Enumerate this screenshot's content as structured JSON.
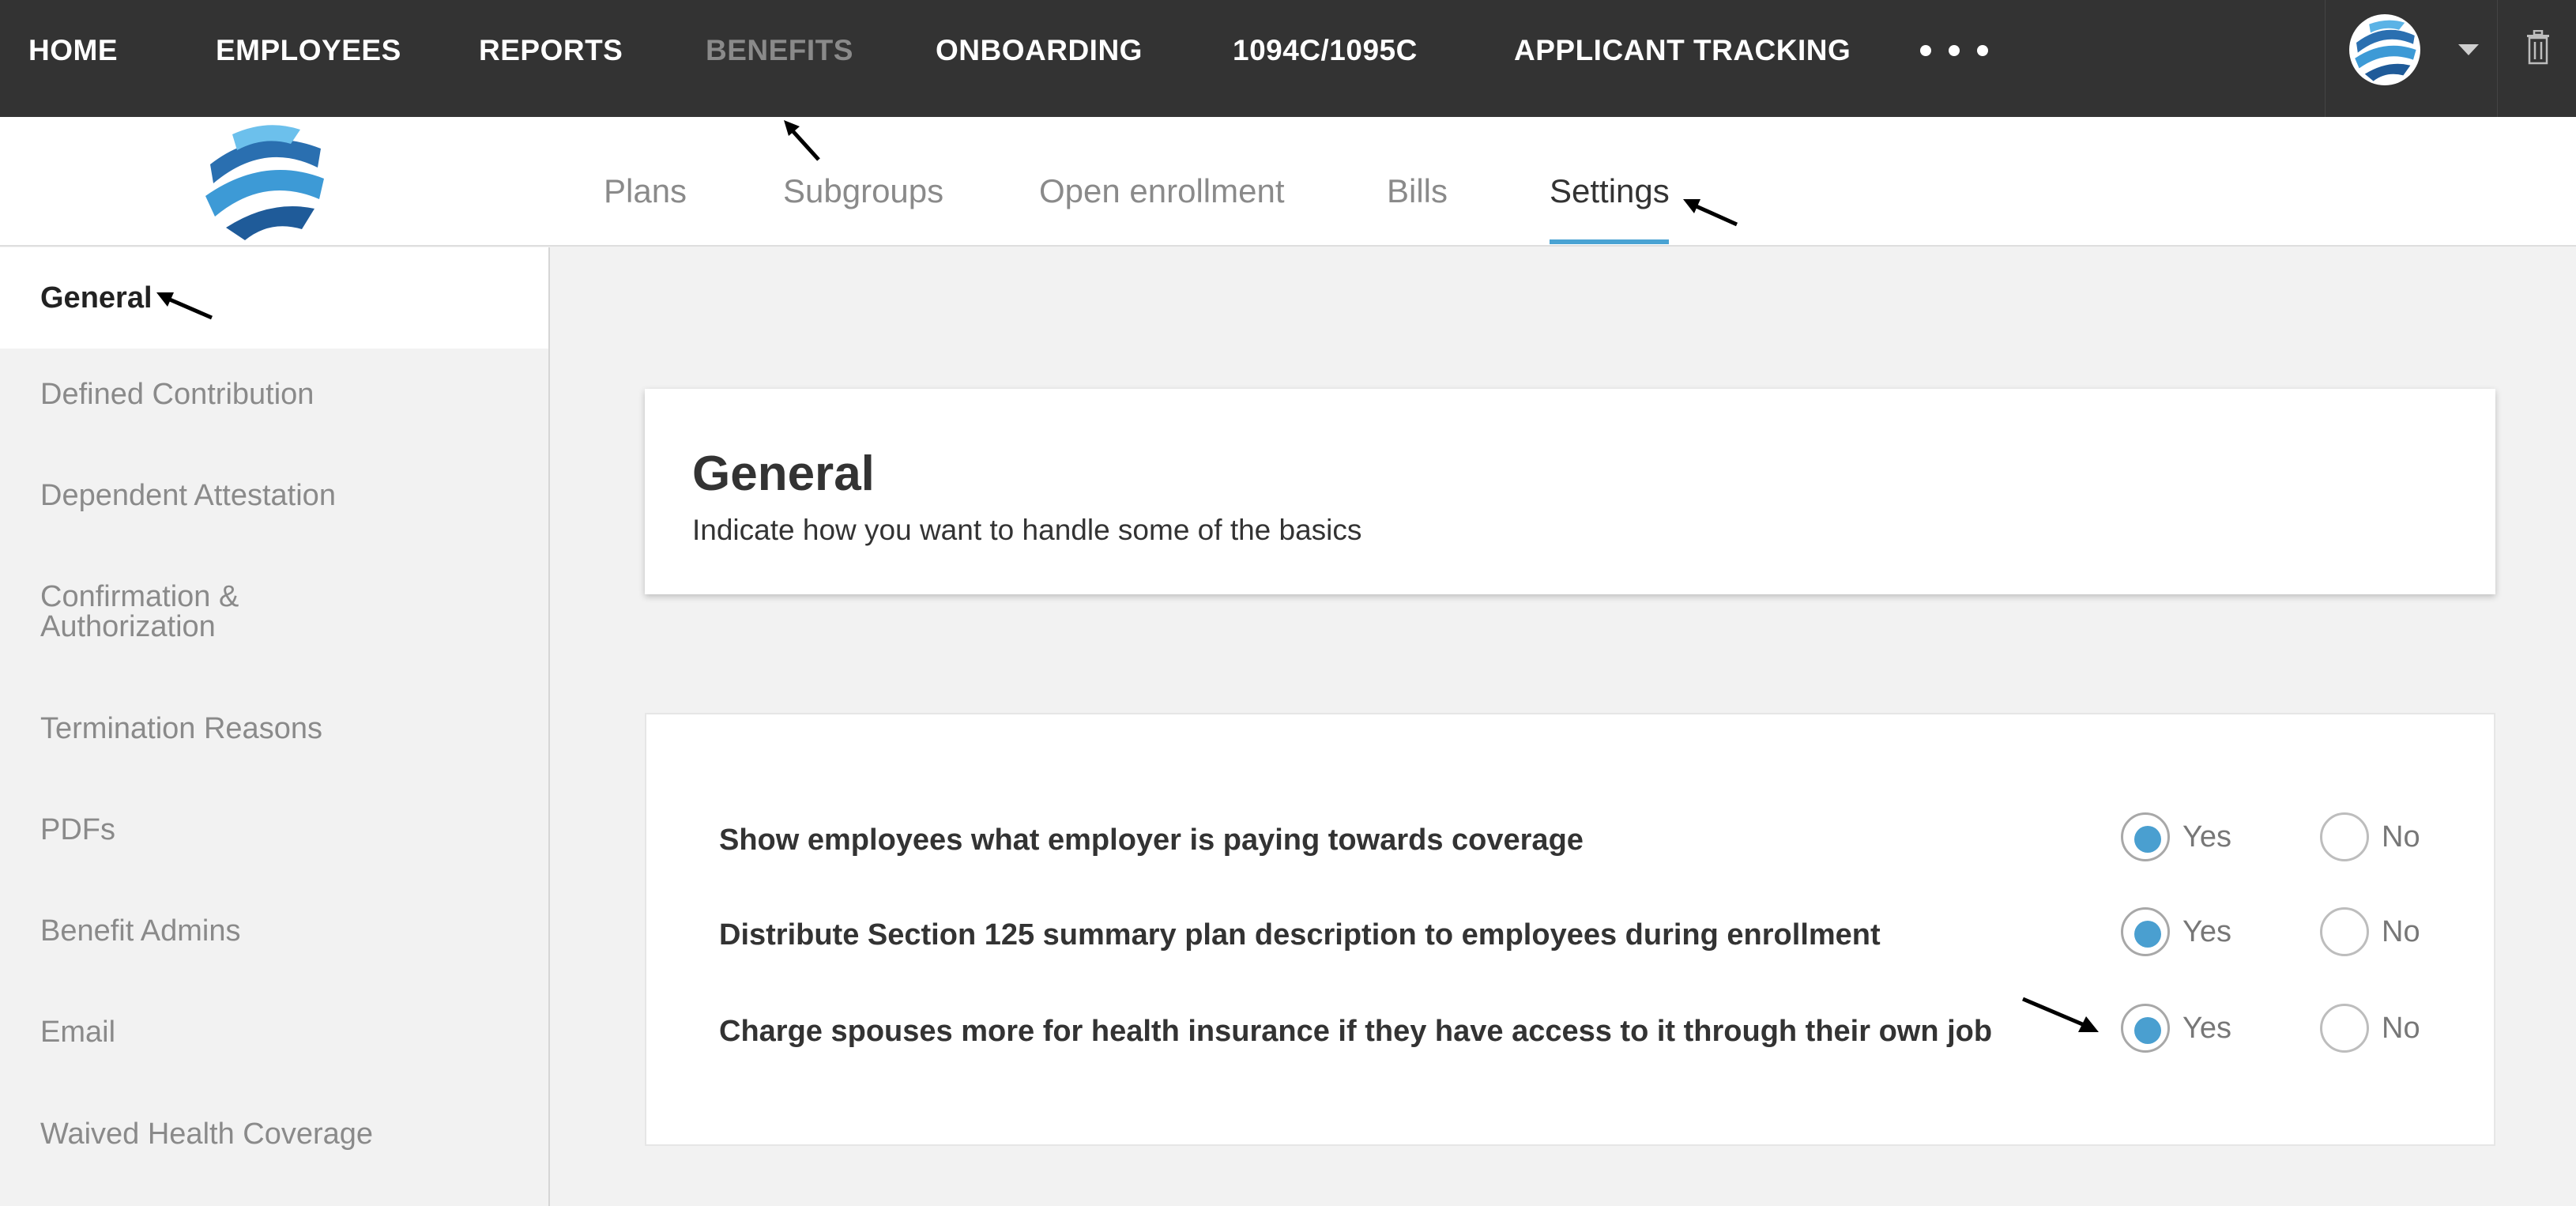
{
  "topnav": {
    "items": [
      {
        "label": "HOME"
      },
      {
        "label": "EMPLOYEES"
      },
      {
        "label": "REPORTS"
      },
      {
        "label": "BENEFITS"
      },
      {
        "label": "ONBOARDING"
      },
      {
        "label": "1094C/1095C"
      },
      {
        "label": "APPLICANT TRACKING"
      }
    ],
    "active_index": 3,
    "more_icon": "ellipsis-icon",
    "avatar_icon": "globe-logo-icon",
    "trash_icon": "trash-icon"
  },
  "subnav": {
    "logo_icon": "globe-logo-icon",
    "tabs": [
      {
        "label": "Plans"
      },
      {
        "label": "Subgroups"
      },
      {
        "label": "Open enrollment"
      },
      {
        "label": "Bills"
      },
      {
        "label": "Settings"
      }
    ],
    "active_index": 4
  },
  "sidebar": {
    "items": [
      {
        "label": "General"
      },
      {
        "label": "Defined Contribution"
      },
      {
        "label": "Dependent Attestation"
      },
      {
        "label": "Confirmation & Authorization"
      },
      {
        "label": "Termination Reasons"
      },
      {
        "label": "PDFs"
      },
      {
        "label": "Benefit Admins"
      },
      {
        "label": "Email"
      },
      {
        "label": "Waived Health Coverage"
      }
    ],
    "active_index": 0
  },
  "main": {
    "title": "General",
    "subtitle": "Indicate how you want to handle some of the basics",
    "options": [
      {
        "label": "Show employees what employer is paying towards coverage",
        "yes": "Yes",
        "no": "No",
        "selected": "Yes"
      },
      {
        "label": "Distribute Section 125 summary plan description to employees during enrollment",
        "yes": "Yes",
        "no": "No",
        "selected": "Yes"
      },
      {
        "label": "Charge spouses more for health insurance if they have access to it through their own job",
        "yes": "Yes",
        "no": "No",
        "selected": "Yes"
      }
    ]
  },
  "colors": {
    "topnav_bg": "#333333",
    "accent": "#4aa3d3",
    "radio_fill": "#4a9fd0",
    "inactive_text": "#8a8a8a"
  }
}
